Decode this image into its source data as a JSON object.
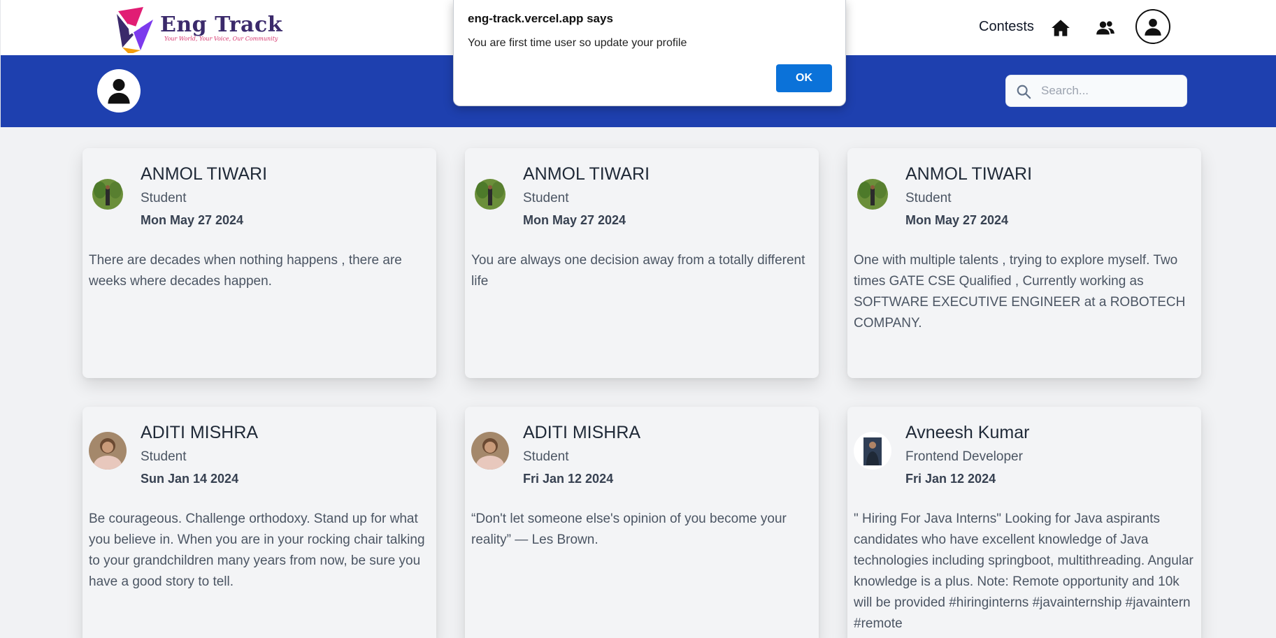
{
  "header": {
    "logo_text": "Eng Track",
    "logo_tagline": "Your World, Your Voice, Our Community",
    "nav": {
      "contests_label": "Contests",
      "home_icon": "home-icon",
      "friends_icon": "users-icon",
      "profile_icon": "user-circle-icon"
    }
  },
  "banner": {
    "avatar_icon": "user-icon",
    "search": {
      "placeholder": "Search...",
      "value": ""
    }
  },
  "posts": [
    {
      "name": "ANMOL TIWARI",
      "role": "Student",
      "date": "Mon May 27 2024",
      "text": "There are decades when nothing happens , there are weeks where decades happen."
    },
    {
      "name": "ANMOL TIWARI",
      "role": "Student",
      "date": "Mon May 27 2024",
      "text": "You are always one decision away from a totally different life"
    },
    {
      "name": "ANMOL TIWARI",
      "role": "Student",
      "date": "Mon May 27 2024",
      "text": "One with multiple talents , trying to explore myself. Two times GATE CSE Qualified , Currently working as SOFTWARE EXECUTIVE ENGINEER at a ROBOTECH COMPANY."
    },
    {
      "name": "ADITI MISHRA",
      "role": "Student",
      "date": "Sun Jan 14 2024",
      "text": "Be courageous. Challenge orthodoxy. Stand up for what you believe in. When you are in your rocking chair talking to your grandchildren many years from now, be sure you have a good story to tell."
    },
    {
      "name": "ADITI MISHRA",
      "role": "Student",
      "date": "Fri Jan 12 2024",
      "text": "“Don't let someone else's opinion of you become your reality” — Les Brown."
    },
    {
      "name": "Avneesh Kumar",
      "role": "Frontend Developer",
      "date": "Fri Jan 12 2024",
      "text": "\" Hiring For Java Interns\" Looking for Java aspirants candidates who have excellent knowledge of Java technologies including springboot, multithreading. Angular knowledge is a plus. Note: Remote opportunity and 10k will be provided #hiringinterns #javainternship #javaintern #remote"
    }
  ],
  "dialog": {
    "title": "eng-track.vercel.app says",
    "message": "You are first time user so update your profile",
    "ok_label": "OK"
  },
  "colors": {
    "banner": "#1e40af",
    "ok_button": "#0b72d9",
    "card_bg": "#f3f4f6"
  }
}
